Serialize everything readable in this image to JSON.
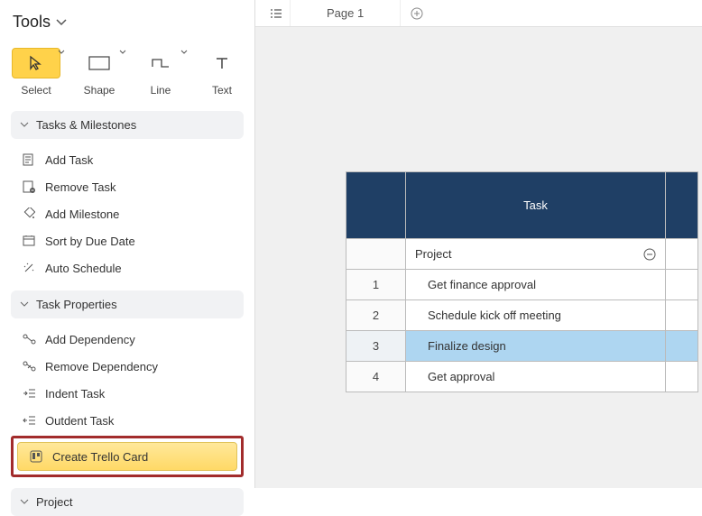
{
  "header": {
    "title": "Tools"
  },
  "toolbar": {
    "select": "Select",
    "shape": "Shape",
    "line": "Line",
    "text": "Text"
  },
  "sections": {
    "tasks_milestones": "Tasks & Milestones",
    "task_properties": "Task Properties",
    "project": "Project"
  },
  "menu_tasks": {
    "add_task": "Add Task",
    "remove_task": "Remove Task",
    "add_milestone": "Add Milestone",
    "sort_due": "Sort by Due Date",
    "auto_schedule": "Auto Schedule"
  },
  "menu_props": {
    "add_dep": "Add Dependency",
    "remove_dep": "Remove Dependency",
    "indent": "Indent Task",
    "outdent": "Outdent Task",
    "create_trello": "Create Trello Card"
  },
  "tabs": {
    "page1": "Page 1"
  },
  "table": {
    "header_task": "Task",
    "project_label": "Project",
    "rows": [
      {
        "n": "1",
        "task": "Get finance approval"
      },
      {
        "n": "2",
        "task": "Schedule kick off meeting"
      },
      {
        "n": "3",
        "task": "Finalize design"
      },
      {
        "n": "4",
        "task": "Get approval"
      }
    ]
  }
}
